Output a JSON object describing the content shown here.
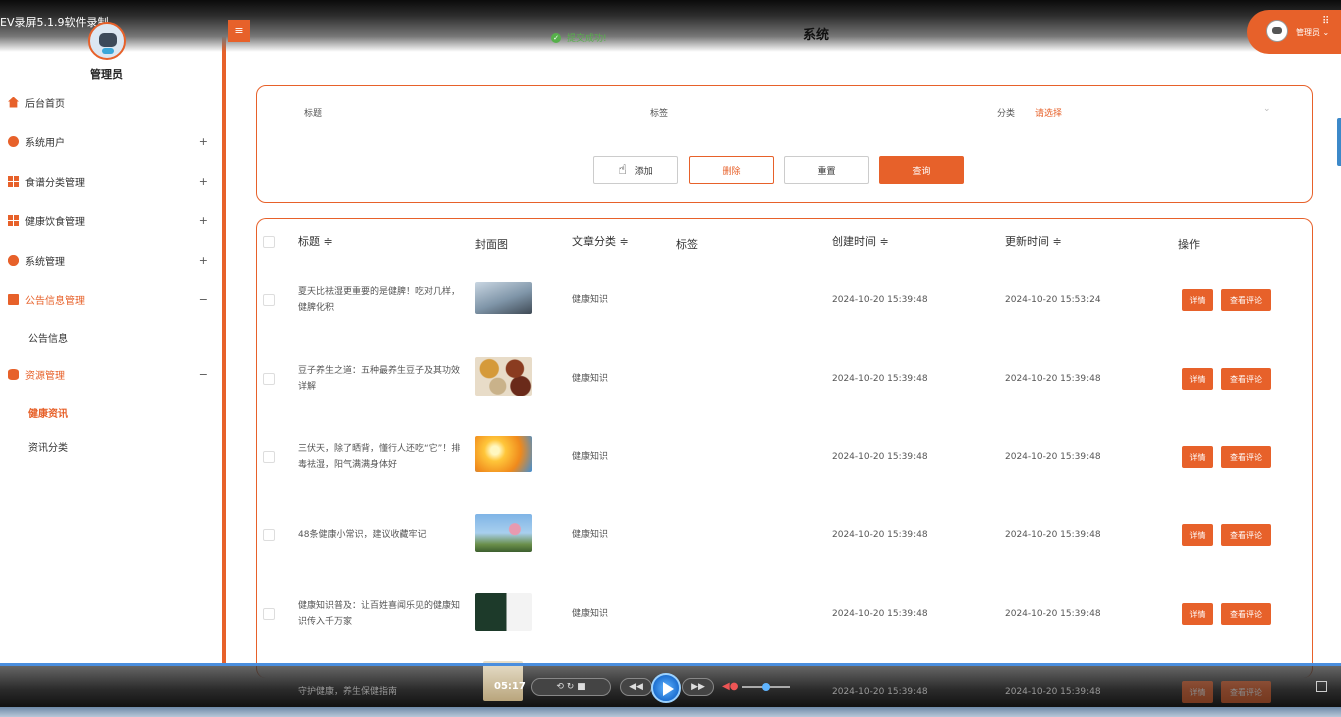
{
  "recorder": {
    "title": "EV录屏5.1.9软件录制"
  },
  "header": {
    "title": "系统",
    "toast": "提交成功!",
    "user": "管理员"
  },
  "sidebar": {
    "username": "管理员",
    "items": [
      {
        "label": "后台首页",
        "icon": "home-icon",
        "toggle": ""
      },
      {
        "label": "系统用户",
        "icon": "user-icon",
        "toggle": "+"
      },
      {
        "label": "食谱分类管理",
        "icon": "grid-icon",
        "toggle": "+"
      },
      {
        "label": "健康饮食管理",
        "icon": "grid-icon",
        "toggle": "+"
      },
      {
        "label": "系统管理",
        "icon": "gear-icon",
        "toggle": "+"
      },
      {
        "label": "公告信息管理",
        "icon": "document-icon",
        "toggle": "−"
      },
      {
        "label": "资源管理",
        "icon": "database-icon",
        "toggle": "−"
      }
    ],
    "sub_notice": "公告信息",
    "sub_resource": [
      "健康资讯",
      "资讯分类"
    ]
  },
  "search": {
    "title_label": "标题",
    "tag_label": "标签",
    "category_label": "分类",
    "category_placeholder": "请选择",
    "add": "添加",
    "delete": "删除",
    "reset": "重置",
    "query": "查询"
  },
  "table": {
    "headers": {
      "title": "标题 ≑",
      "cover": "封面图",
      "category": "文章分类 ≑",
      "tag": "标签",
      "created": "创建时间 ≑",
      "updated": "更新时间 ≑",
      "actions": "操作"
    },
    "detail_label": "详情",
    "comment_label": "查看评论",
    "rows": [
      {
        "title": "夏天比祛湿更重要的是健脾！吃对几样，健脾化积",
        "category": "健康知识",
        "created": "2024-10-20 15:39:48",
        "updated": "2024-10-20 15:53:24"
      },
      {
        "title": "豆子养生之道：五种最养生豆子及其功效详解",
        "category": "健康知识",
        "created": "2024-10-20 15:39:48",
        "updated": "2024-10-20 15:39:48"
      },
      {
        "title": "三伏天，除了晒背，懂行人还吃“它”！排毒祛湿，阳气满满身体好",
        "category": "健康知识",
        "created": "2024-10-20 15:39:48",
        "updated": "2024-10-20 15:39:48"
      },
      {
        "title": "48条健康小常识，建议收藏牢记",
        "category": "健康知识",
        "created": "2024-10-20 15:39:48",
        "updated": "2024-10-20 15:39:48"
      },
      {
        "title": "健康知识普及：让百姓喜闻乐见的健康知识传入千万家",
        "category": "健康知识",
        "created": "2024-10-20 15:39:48",
        "updated": "2024-10-20 15:39:48"
      },
      {
        "title": "守护健康，养生保健指南",
        "category": "健康知识",
        "created": "2024-10-20 15:39:48",
        "updated": "2024-10-20 15:39:48"
      }
    ]
  },
  "player": {
    "time": "05:17"
  },
  "colors": {
    "accent": "#e7612a",
    "success": "#57b04b",
    "player_blue": "#1d6fd0"
  }
}
